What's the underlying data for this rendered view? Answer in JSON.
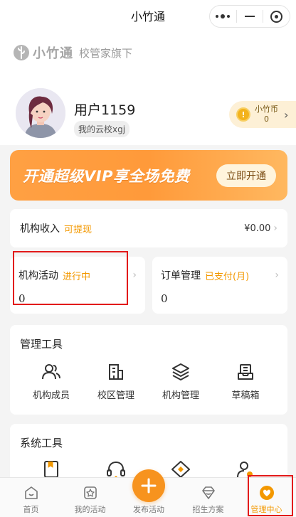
{
  "titlebar": {
    "title": "小竹通"
  },
  "brand": {
    "name": "小竹通",
    "subtitle": "校管家旗下"
  },
  "profile": {
    "username": "用户1159",
    "cloud_school": "我的云校xgj",
    "coin_label": "小竹币",
    "coin_value": "0"
  },
  "vip_banner": {
    "text": "开通超级VIP享全场免费",
    "button": "立即开通"
  },
  "income": {
    "label": "机构收入",
    "tag": "可提现",
    "amount": "¥0.00"
  },
  "activity": {
    "label": "机构活动",
    "tag": "进行中",
    "value": "0"
  },
  "orders": {
    "label": "订单管理",
    "tag": "已支付(月)",
    "value": "0"
  },
  "tools": {
    "header": "管理工具",
    "items": [
      {
        "label": "机构成员",
        "icon": "members-icon"
      },
      {
        "label": "校区管理",
        "icon": "campus-icon"
      },
      {
        "label": "机构管理",
        "icon": "layers-icon"
      },
      {
        "label": "草稿箱",
        "icon": "drafts-icon"
      }
    ]
  },
  "system": {
    "header": "系统工具",
    "items": [
      {
        "icon": "book-icon"
      },
      {
        "icon": "headset-icon"
      },
      {
        "icon": "diamond-icon"
      },
      {
        "icon": "user-settings-icon"
      }
    ]
  },
  "tabbar": {
    "items": [
      {
        "label": "首页",
        "icon": "home-icon"
      },
      {
        "label": "我的活动",
        "icon": "star-box-icon"
      },
      {
        "label": "发布活动",
        "icon": "plus-icon"
      },
      {
        "label": "招生方案",
        "icon": "gem-icon"
      },
      {
        "label": "管理中心",
        "icon": "manage-icon"
      }
    ],
    "active": "管理中心"
  },
  "colors": {
    "accent": "#f39800",
    "highlight": "#e21a1a",
    "banner": "#ffa043"
  }
}
